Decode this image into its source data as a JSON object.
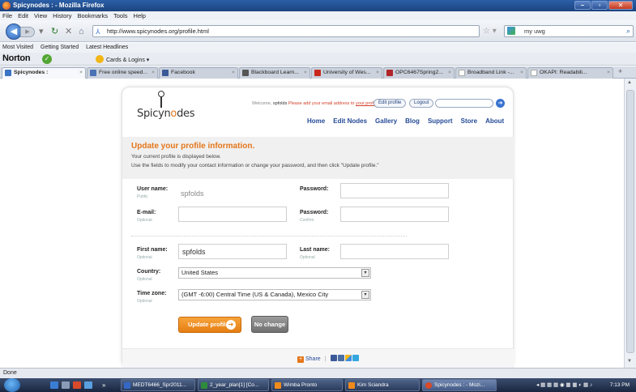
{
  "window": {
    "title": "Spicynodes : - Mozilla Firefox"
  },
  "menu": [
    "File",
    "Edit",
    "View",
    "History",
    "Bookmarks",
    "Tools",
    "Help"
  ],
  "nav": {
    "url": "http://www.spicynodes.org/profile.html",
    "search_value": "my uwg"
  },
  "bookmarks": [
    "Most Visited",
    "Getting Started",
    "Latest Headlines"
  ],
  "norton": {
    "logo": "Norton",
    "cards": "Cards & Logins"
  },
  "tabs": [
    {
      "label": "Spicynodes :",
      "active": true
    },
    {
      "label": "Free online speed..."
    },
    {
      "label": "Facebook"
    },
    {
      "label": "Blackboard Learn..."
    },
    {
      "label": "University of Wes..."
    },
    {
      "label": "OPC6467Spring2..."
    },
    {
      "label": "Broadband Link -..."
    },
    {
      "label": "OKAPI: Readabili..."
    }
  ],
  "site": {
    "brand_pre": "Spicyn",
    "brand_o": "o",
    "brand_post": "des",
    "welcome_pre": "Welcome,",
    "welcome_user": "spfolds",
    "welcome_msg": "Please add your email address to",
    "welcome_link": "your profile.",
    "edit_profile": "Edit profile",
    "logout": "Logout",
    "nav": [
      "Home",
      "Edit Nodes",
      "Gallery",
      "Blog",
      "Support",
      "Store",
      "About"
    ]
  },
  "profile": {
    "heading": "Update your profile information.",
    "line1": "Your current profile is displayed below.",
    "line2": "Use the fields to modify your contact information or change your password, and then click \"Update profile.\"",
    "username_label": "User name:",
    "username_sub": "Public",
    "username_value": "spfolds",
    "password_label": "Password:",
    "email_label": "E-mail:",
    "email_sub": "Optional",
    "password2_label": "Password:",
    "password2_sub": "Confirm",
    "firstname_label": "First name:",
    "firstname_sub": "Optional",
    "firstname_value": "spfolds",
    "lastname_label": "Last name:",
    "lastname_sub": "Optional",
    "country_label": "Country:",
    "country_sub": "Optional",
    "country_value": "United States",
    "timezone_label": "Time zone:",
    "timezone_sub": "Optional",
    "timezone_value": "(GMT -6:00) Central Time (US & Canada), Mexico City",
    "update_btn": "Update profile",
    "nochange_btn": "No change",
    "share": "Share"
  },
  "status": "Done",
  "taskbar": {
    "items": [
      "MEDT6466_Spr2011...",
      "2_year_plan[1] [Co...",
      "Wimba Pronto",
      "Kim Sciandra",
      "Spicynodes : - Mozi..."
    ],
    "clock": "7:13 PM"
  },
  "colors": {
    "accent": "#e4761a",
    "link": "#254a97"
  }
}
